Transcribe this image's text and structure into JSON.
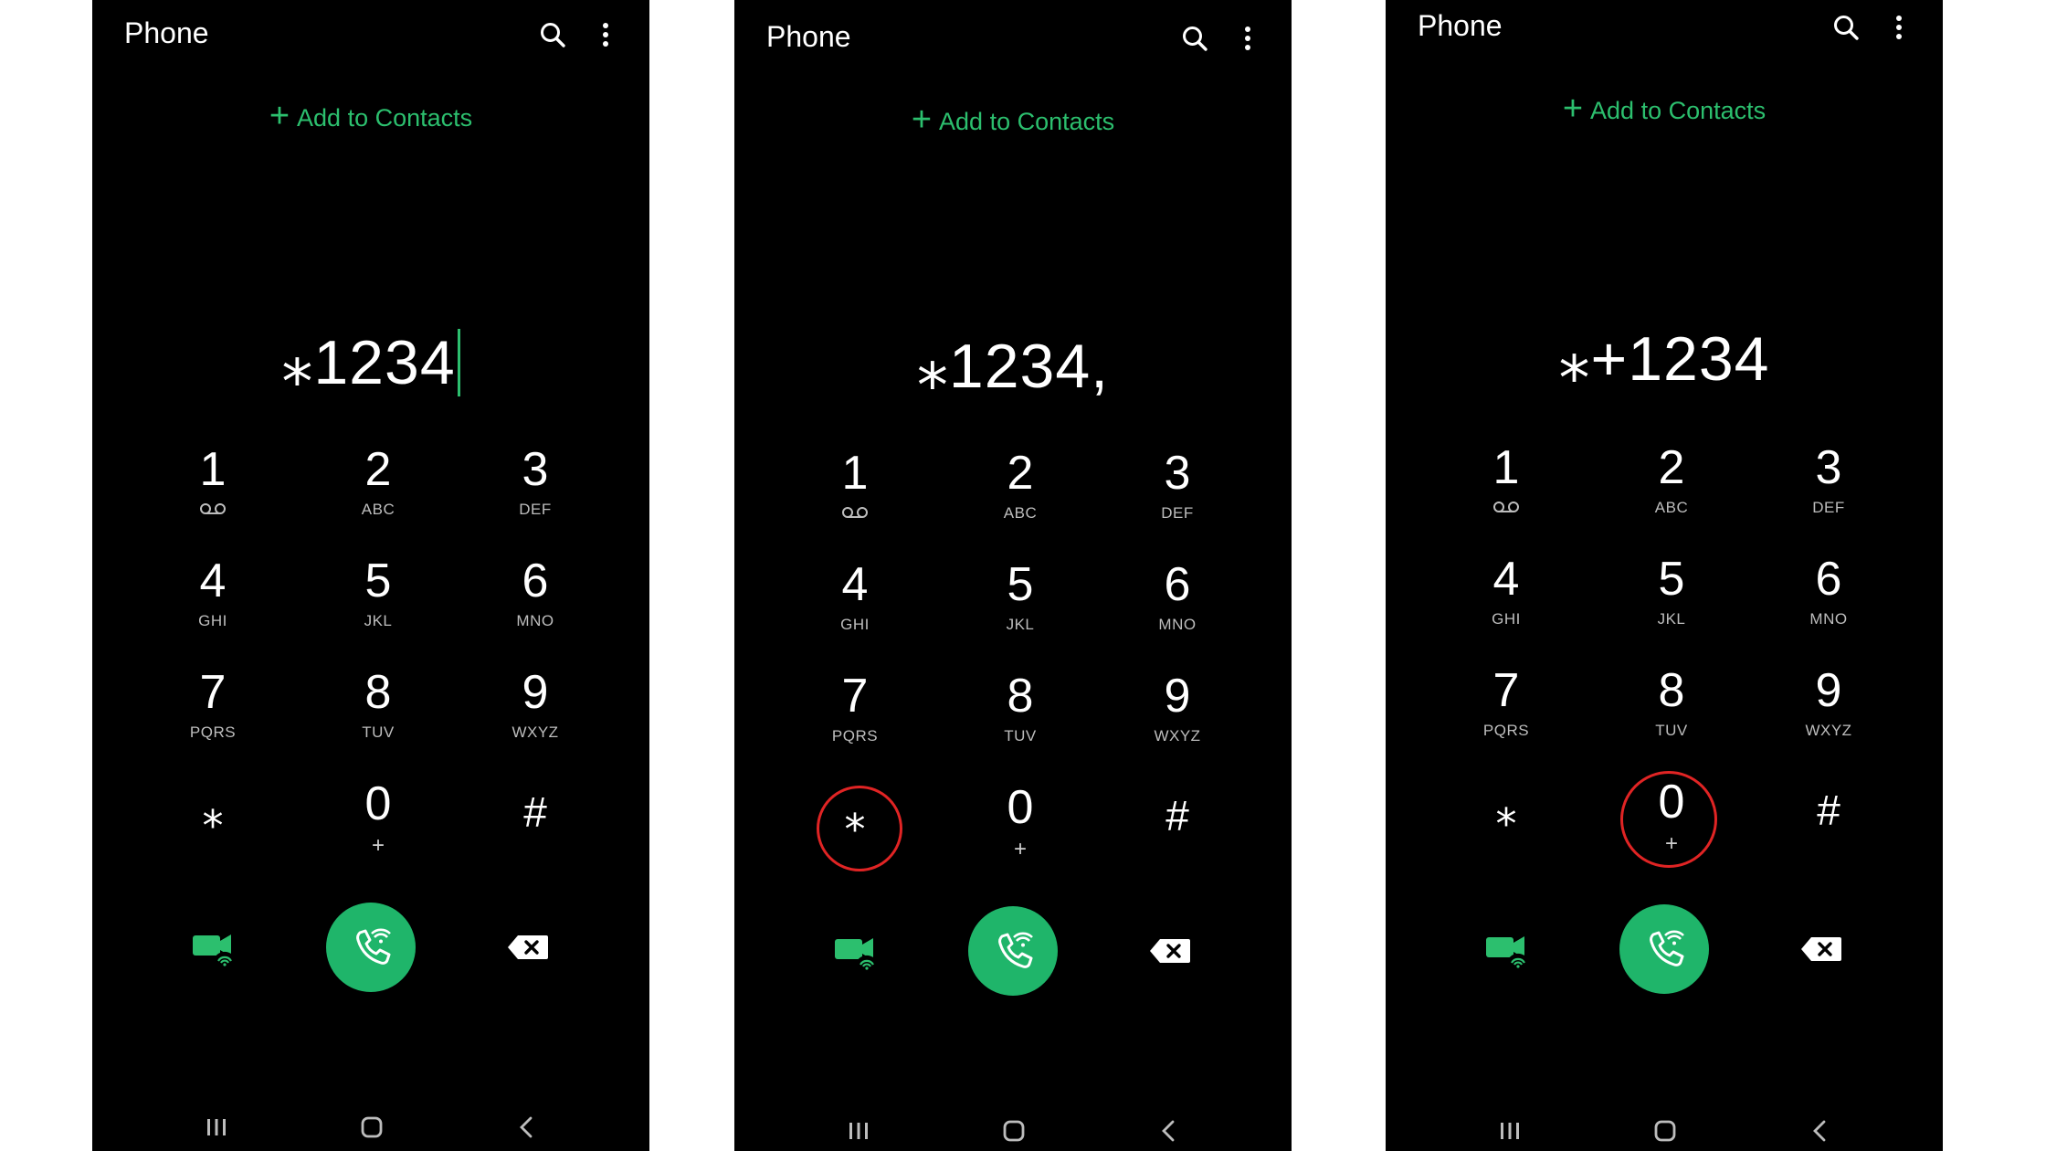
{
  "colors": {
    "background": "#000000",
    "accent": "#2cbf6e",
    "call_button": "#1fb56a",
    "highlight_ring": "#e02424",
    "secondary_text": "#bdbdbd"
  },
  "icons": {
    "search": "search-icon",
    "more": "more-vert-icon",
    "video_call": "video-call-wifi-icon",
    "call": "wifi-call-icon",
    "backspace": "backspace-icon",
    "voicemail": "voicemail-icon",
    "nav_recents": "recents-icon",
    "nav_home": "home-icon",
    "nav_back": "back-icon"
  },
  "phones": [
    {
      "app_title": "Phone",
      "add_to_contacts": "Add to Contacts",
      "dialed_number": "⁎1234",
      "cursor_visible": true,
      "highlighted_key": null
    },
    {
      "app_title": "Phone",
      "add_to_contacts": "Add to Contacts",
      "dialed_number": "⁎1234,",
      "cursor_visible": false,
      "highlighted_key": "*"
    },
    {
      "app_title": "Phone",
      "add_to_contacts": "Add to Contacts",
      "dialed_number": "⁎+1234",
      "cursor_visible": false,
      "highlighted_key": "0"
    }
  ],
  "keypad": [
    {
      "digit": "1",
      "letters": "",
      "voicemail": true
    },
    {
      "digit": "2",
      "letters": "ABC"
    },
    {
      "digit": "3",
      "letters": "DEF"
    },
    {
      "digit": "4",
      "letters": "GHI"
    },
    {
      "digit": "5",
      "letters": "JKL"
    },
    {
      "digit": "6",
      "letters": "MNO"
    },
    {
      "digit": "7",
      "letters": "PQRS"
    },
    {
      "digit": "8",
      "letters": "TUV"
    },
    {
      "digit": "9",
      "letters": "WXYZ"
    },
    {
      "digit": "⁎",
      "letters": ""
    },
    {
      "digit": "0",
      "letters": "+"
    },
    {
      "digit": "#",
      "letters": ""
    }
  ]
}
